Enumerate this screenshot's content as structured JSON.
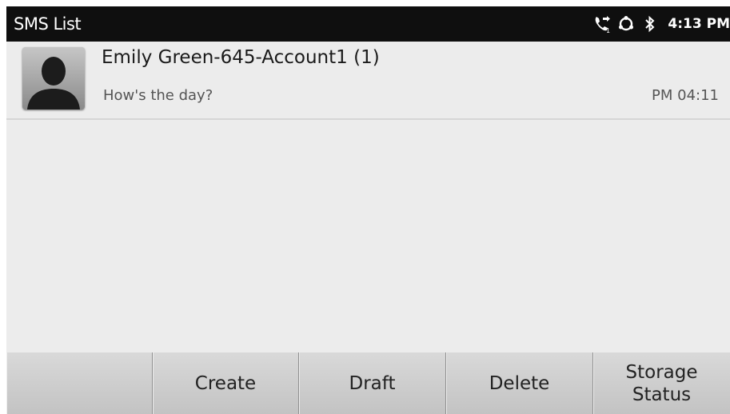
{
  "statusbar": {
    "title": "SMS List",
    "clock": "4:13 PM",
    "icons": [
      "call-forward-icon",
      "network-icon",
      "bluetooth-icon"
    ]
  },
  "messages": [
    {
      "name": "Emily Green-645-Account1 (1)",
      "preview": "How's the day?",
      "time": "PM 04:11",
      "avatar": "person-silhouette-icon"
    }
  ],
  "softkeys": [
    "",
    "Create",
    "Draft",
    "Delete",
    "Storage\nStatus"
  ],
  "colors": {
    "statusbar": "#0f0f0f",
    "list_background": "#ececec",
    "softkey_bar": "#cfcfcf"
  }
}
